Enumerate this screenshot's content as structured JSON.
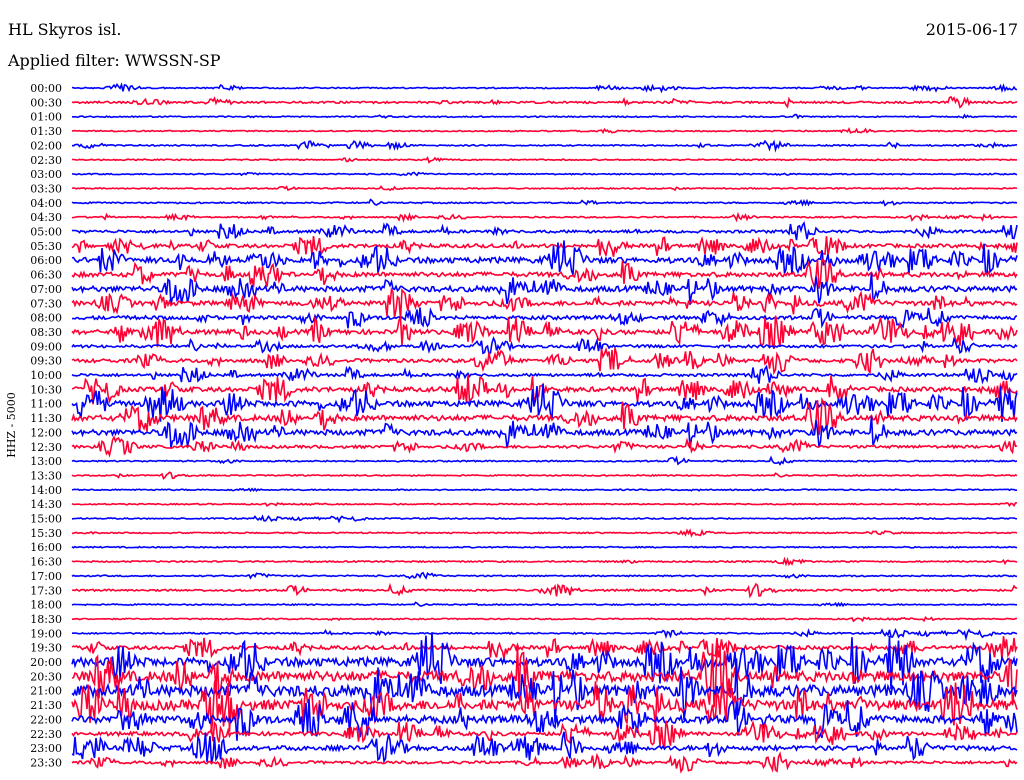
{
  "header": {
    "station": "HL Skyros isl.",
    "date": "2015-06-17",
    "filter": "Applied filter: WWSSN-SP"
  },
  "chart_data": {
    "type": "line",
    "title": "HL Skyros isl.",
    "channel_label": "HHZ - 5000",
    "colors": [
      "#0000ff",
      "#ff0033"
    ],
    "rows": [
      {
        "label": "00:00",
        "amp": 1.2
      },
      {
        "label": "00:30",
        "amp": 2.2
      },
      {
        "label": "01:00",
        "amp": 1.0
      },
      {
        "label": "01:30",
        "amp": 1.2
      },
      {
        "label": "02:00",
        "amp": 1.4
      },
      {
        "label": "02:30",
        "amp": 0.8
      },
      {
        "label": "03:00",
        "amp": 0.8
      },
      {
        "label": "03:30",
        "amp": 0.8
      },
      {
        "label": "04:00",
        "amp": 1.5
      },
      {
        "label": "04:30",
        "amp": 1.5
      },
      {
        "label": "05:00",
        "amp": 3.0
      },
      {
        "label": "05:30",
        "amp": 4.0
      },
      {
        "label": "06:00",
        "amp": 6.0
      },
      {
        "label": "06:30",
        "amp": 5.0
      },
      {
        "label": "07:00",
        "amp": 6.0
      },
      {
        "label": "07:30",
        "amp": 5.0
      },
      {
        "label": "08:00",
        "amp": 4.0
      },
      {
        "label": "08:30",
        "amp": 5.0
      },
      {
        "label": "09:00",
        "amp": 3.0
      },
      {
        "label": "09:30",
        "amp": 4.0
      },
      {
        "label": "10:00",
        "amp": 3.0
      },
      {
        "label": "10:30",
        "amp": 5.0
      },
      {
        "label": "11:00",
        "amp": 6.0
      },
      {
        "label": "11:30",
        "amp": 6.0
      },
      {
        "label": "12:00",
        "amp": 6.0
      },
      {
        "label": "12:30",
        "amp": 3.0
      },
      {
        "label": "13:00",
        "amp": 1.5
      },
      {
        "label": "13:30",
        "amp": 1.0
      },
      {
        "label": "14:00",
        "amp": 0.8
      },
      {
        "label": "14:30",
        "amp": 0.8
      },
      {
        "label": "15:00",
        "amp": 1.0
      },
      {
        "label": "15:30",
        "amp": 1.0
      },
      {
        "label": "16:00",
        "amp": 1.0
      },
      {
        "label": "16:30",
        "amp": 1.5
      },
      {
        "label": "17:00",
        "amp": 1.5
      },
      {
        "label": "17:30",
        "amp": 2.0
      },
      {
        "label": "18:00",
        "amp": 1.0
      },
      {
        "label": "18:30",
        "amp": 1.0
      },
      {
        "label": "19:00",
        "amp": 1.6
      },
      {
        "label": "19:30",
        "amp": 4.0
      },
      {
        "label": "20:00",
        "amp": 9.0
      },
      {
        "label": "20:30",
        "amp": 11.0
      },
      {
        "label": "21:00",
        "amp": 12.0
      },
      {
        "label": "21:30",
        "amp": 11.0
      },
      {
        "label": "22:00",
        "amp": 8.0
      },
      {
        "label": "22:30",
        "amp": 4.0
      },
      {
        "label": "23:00",
        "amp": 5.0
      },
      {
        "label": "23:30",
        "amp": 3.0
      }
    ]
  }
}
